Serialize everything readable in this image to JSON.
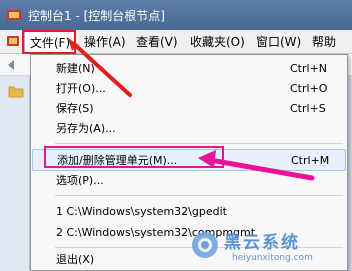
{
  "window": {
    "title": "控制台1 - [控制台根节点]"
  },
  "menubar": {
    "items": [
      {
        "label": "文件(F)"
      },
      {
        "label": "操作(A)"
      },
      {
        "label": "查看(V)"
      },
      {
        "label": "收藏夹(O)"
      },
      {
        "label": "窗口(W)"
      },
      {
        "label": "帮助(H)"
      }
    ]
  },
  "file_menu": {
    "items": [
      {
        "label": "新建(N)",
        "accel": "Ctrl+N"
      },
      {
        "label": "打开(O)...",
        "accel": "Ctrl+O"
      },
      {
        "label": "保存(S)",
        "accel": "Ctrl+S"
      },
      {
        "label": "另存为(A)...",
        "accel": ""
      },
      {
        "label": "添加/删除管理单元(M)...",
        "accel": "Ctrl+M"
      },
      {
        "label": "选项(P)...",
        "accel": ""
      },
      {
        "label": "1 C:\\Windows\\system32\\gpedit",
        "accel": ""
      },
      {
        "label": "2 C:\\Windows\\system32\\compmgmt",
        "accel": ""
      },
      {
        "label": "退出(X)",
        "accel": ""
      }
    ]
  },
  "watermark": {
    "title": "黑云系统",
    "url": "heiyunxitong.com"
  },
  "colors": {
    "highlight_red": "#e02020",
    "annotation_pink": "#e8139a",
    "titlebar": "#5c7da8"
  }
}
